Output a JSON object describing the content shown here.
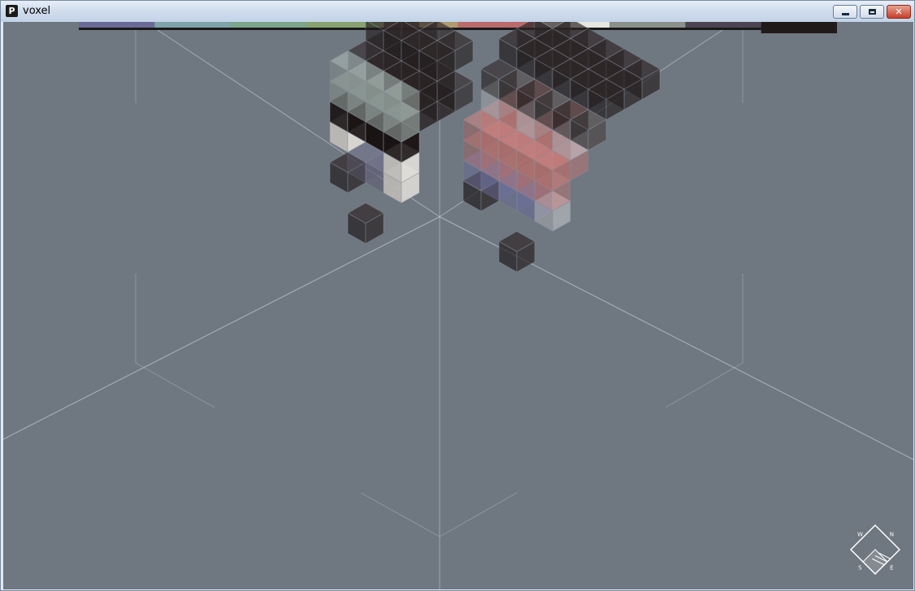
{
  "window": {
    "title": "voxel",
    "app_icon_glyph": "P"
  },
  "window_controls": {
    "minimize": "minimize-icon",
    "maximize": "maximize-icon",
    "close": "close-icon"
  },
  "palette": {
    "colors": [
      "#6a6a99",
      "#7ea3a8",
      "#7ca58c",
      "#88a270",
      "#b19a6e",
      "#b96a6a",
      "#e8e6e1",
      "#8a908a",
      "#4c4452",
      "#211a1b"
    ],
    "selected_index": 9
  },
  "scene": {
    "background": "#6f7780",
    "model_count": 2
  },
  "compass": {
    "labels": [
      "W",
      "N",
      "S",
      "E"
    ]
  }
}
